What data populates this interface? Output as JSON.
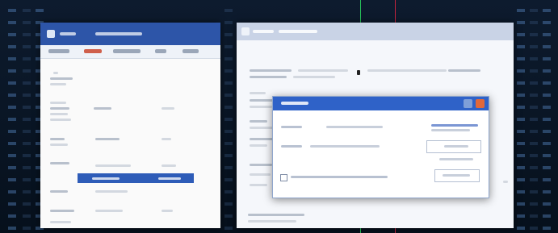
{
  "background": {
    "style": "matrix-code",
    "colors": {
      "base": "#0a1424",
      "glyph": "#4670a0",
      "green_line": "#27c25a",
      "red_line": "#c4243f"
    }
  },
  "left_window": {
    "title": "",
    "menu": [
      {
        "label": "",
        "active": false
      },
      {
        "label": "",
        "active": true
      },
      {
        "label": "",
        "active": false
      },
      {
        "label": "",
        "active": false
      },
      {
        "label": "",
        "active": false
      }
    ],
    "selected_item": "",
    "colors": {
      "titlebar": "#2d55a8",
      "selection": "#2e5cb8",
      "active_tab": "#cf5f4b"
    }
  },
  "right_window": {
    "title": "",
    "dialog": {
      "title": "",
      "checkbox_label": "",
      "checkbox_checked": false,
      "colors": {
        "titlebar": "#2f62c8",
        "close": "#e2683a",
        "link": "#7b96d4"
      }
    }
  }
}
